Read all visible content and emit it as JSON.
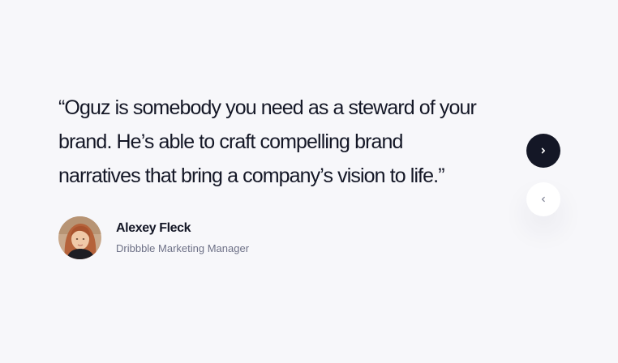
{
  "testimonial": {
    "quote": "“Oguz is somebody you need as a steward of your brand. He’s able to craft compelling brand narratives that bring a company’s vision to life.”"
  },
  "author": {
    "name": "Alexey Fleck",
    "role": "Dribbble Marketing Manager",
    "avatar_icon": "avatar-photo"
  },
  "navigation": {
    "next_icon": "chevron-right-icon",
    "prev_icon": "chevron-left-icon"
  },
  "colors": {
    "background": "#f7f7fa",
    "text_primary": "#141726",
    "text_secondary": "#6e7187",
    "next_button_bg": "#141726",
    "prev_button_bg": "#ffffff"
  }
}
